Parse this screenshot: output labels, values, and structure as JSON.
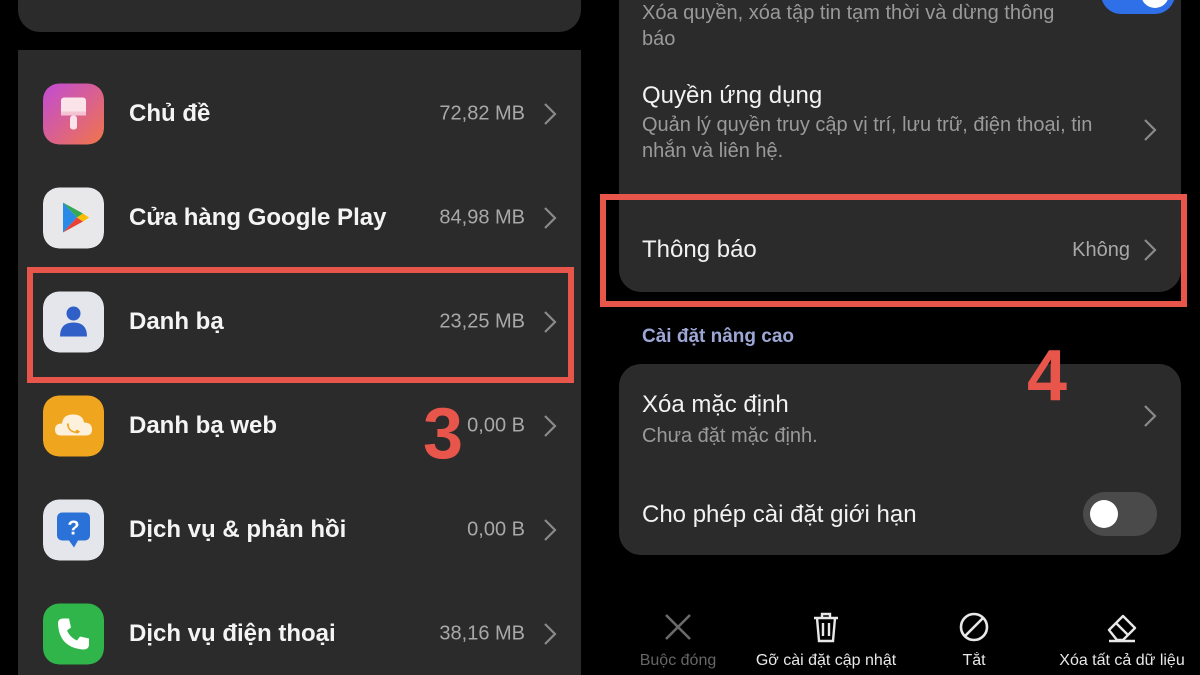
{
  "left": {
    "apps": [
      {
        "name": "Chủ đề",
        "size": "72,82 MB",
        "icon": "theme-brush-icon"
      },
      {
        "name": "Cửa hàng Google Play",
        "size": "84,98 MB",
        "icon": "google-play-icon"
      },
      {
        "name": "Danh bạ",
        "size": "23,25 MB",
        "icon": "contacts-person-icon"
      },
      {
        "name": "Danh bạ web",
        "size": "0,00 B",
        "icon": "cloud-phone-icon"
      },
      {
        "name": "Dịch vụ & phản hồi",
        "size": "0,00 B",
        "icon": "help-question-icon"
      },
      {
        "name": "Dịch vụ điện thoại",
        "size": "38,16 MB",
        "icon": "phone-handset-icon"
      }
    ],
    "step_label": "3"
  },
  "right": {
    "top_item_sub": "Xóa quyền, xóa tập tin tạm thời và dừng thông báo",
    "permissions": {
      "title": "Quyền ứng dụng",
      "sub": "Quản lý quyền truy cập vị trí, lưu trữ, điện thoại, tin nhắn và liên hệ."
    },
    "notifications": {
      "title": "Thông báo",
      "value": "Không"
    },
    "advanced_header": "Cài đặt nâng cao",
    "clear_defaults": {
      "title": "Xóa mặc định",
      "sub": "Chưa đặt mặc định."
    },
    "allow_restricted": {
      "title": "Cho phép cài đặt giới hạn"
    },
    "actions": [
      {
        "label": "Buộc đóng",
        "icon": "close-x-icon",
        "enabled": false
      },
      {
        "label": "Gỡ cài đặt cập nhật",
        "icon": "trash-icon",
        "enabled": true
      },
      {
        "label": "Tắt",
        "icon": "disable-icon",
        "enabled": true
      },
      {
        "label": "Xóa tất cả dữ liệu",
        "icon": "eraser-icon",
        "enabled": true
      }
    ],
    "step_label": "4"
  },
  "colors": {
    "annotation": "#e8554a",
    "toggle_on": "#2f6fe8",
    "card": "#2b2b2b",
    "section_header": "#9da7d6"
  }
}
